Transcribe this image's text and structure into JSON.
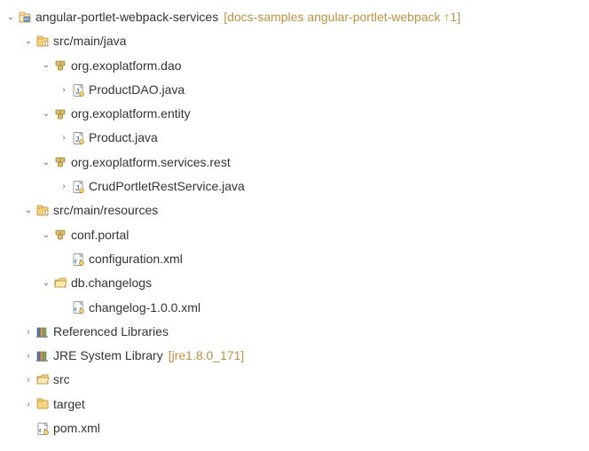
{
  "tree": {
    "root": {
      "label": "angular-portlet-webpack-services",
      "decoration": "[docs-samples angular-portlet-webpack ↑1]"
    },
    "srcMainJava": {
      "label": "src/main/java"
    },
    "pkgDao": {
      "label": "org.exoplatform.dao"
    },
    "fileProductDao": {
      "label": "ProductDAO.java"
    },
    "pkgEntity": {
      "label": "org.exoplatform.entity"
    },
    "fileProduct": {
      "label": "Product.java"
    },
    "pkgServicesRest": {
      "label": "org.exoplatform.services.rest"
    },
    "fileCrudRest": {
      "label": "CrudPortletRestService.java"
    },
    "srcMainResources": {
      "label": "src/main/resources"
    },
    "confPortal": {
      "label": "conf.portal"
    },
    "fileConfiguration": {
      "label": "configuration.xml"
    },
    "dbChangelogs": {
      "label": "db.changelogs"
    },
    "fileChangelog": {
      "label": "changelog-1.0.0.xml"
    },
    "refLibs": {
      "label": "Referenced Libraries"
    },
    "jre": {
      "label": "JRE System Library",
      "decoration": "[jre1.8.0_171]"
    },
    "srcFolder": {
      "label": "src"
    },
    "targetFolder": {
      "label": "target"
    },
    "pom": {
      "label": "pom.xml"
    }
  }
}
